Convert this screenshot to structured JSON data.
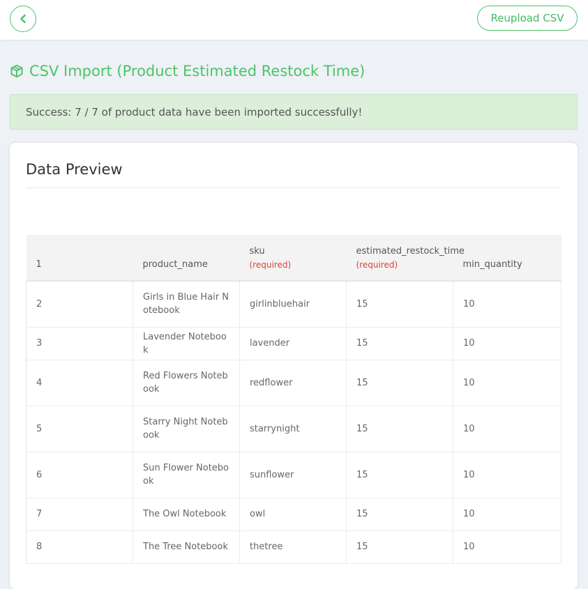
{
  "header": {
    "reupload_label": "Reupload CSV"
  },
  "page": {
    "title": "CSV Import (Product Estimated Restock Time)"
  },
  "alert": {
    "message": "Success: 7 / 7 of product data have been imported successfully!"
  },
  "card": {
    "title": "Data Preview"
  },
  "table": {
    "header": {
      "row_number": "1",
      "columns": [
        {
          "name": "product_name",
          "required_label": ""
        },
        {
          "name": "sku",
          "required_label": "(required)"
        },
        {
          "name": "estimated_restock_time",
          "required_label": "(required)"
        },
        {
          "name": "min_quantity",
          "required_label": ""
        }
      ]
    },
    "rows": [
      {
        "num": "2",
        "product_name": "Girls in Blue Hair Notebook",
        "sku": "girlinbluehair",
        "restock": "15",
        "min_qty": "10"
      },
      {
        "num": "3",
        "product_name": "Lavender Notebook",
        "sku": "lavender",
        "restock": "15",
        "min_qty": "10"
      },
      {
        "num": "4",
        "product_name": "Red Flowers Notebook",
        "sku": "redflower",
        "restock": "15",
        "min_qty": "10"
      },
      {
        "num": "5",
        "product_name": "Starry Night Notebook",
        "sku": "starrynight",
        "restock": "15",
        "min_qty": "10"
      },
      {
        "num": "6",
        "product_name": "Sun Flower Notebook",
        "sku": "sunflower",
        "restock": "15",
        "min_qty": "10"
      },
      {
        "num": "7",
        "product_name": "The Owl Notebook",
        "sku": "owl",
        "restock": "15",
        "min_qty": "10"
      },
      {
        "num": "8",
        "product_name": "The Tree Notebook",
        "sku": "thetree",
        "restock": "15",
        "min_qty": "10"
      }
    ]
  },
  "icons": {
    "back": "chevron-left-icon",
    "title": "cube-icon"
  },
  "colors": {
    "accent": "#4cc36b",
    "success_bg": "#dcefd9",
    "required": "#e0403e"
  }
}
